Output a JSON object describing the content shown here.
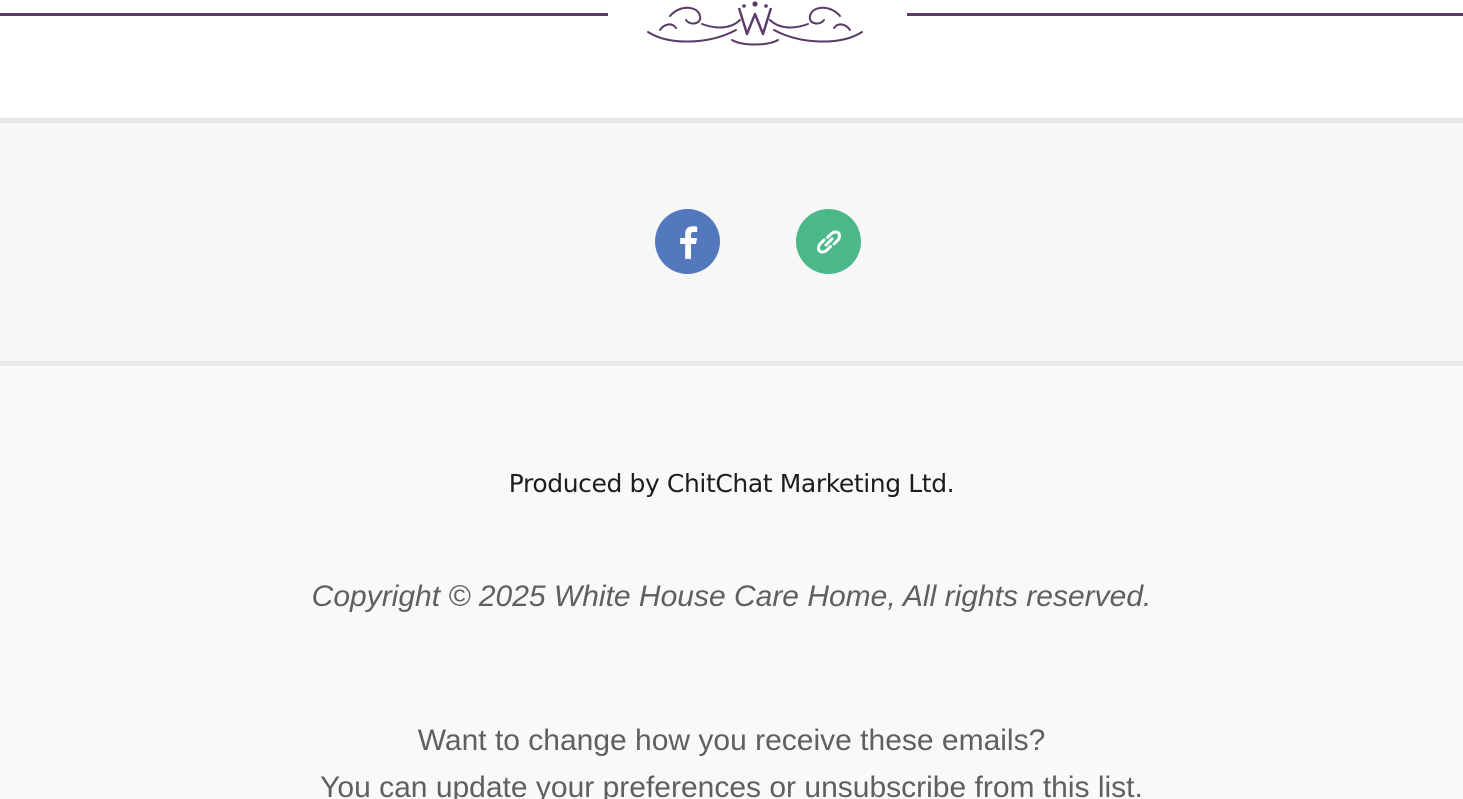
{
  "footer": {
    "produced_by": "Produced by ChitChat Marketing Ltd.",
    "copyright": "Copyright © 2025 White House Care Home, All rights reserved.",
    "preferences_question": "Want to change how you receive these emails?",
    "preferences_prefix": "You can ",
    "update_preferences_link": "update your preferences",
    "preferences_middle": " or ",
    "unsubscribe_link": "unsubscribe from this list",
    "preferences_suffix": "."
  },
  "social": {
    "icons": [
      "facebook-icon",
      "link-icon"
    ]
  },
  "colors": {
    "divider": "#5a3a66",
    "facebook": "#5478be",
    "website": "#4bb889",
    "footer_bg": "#f9f9f9"
  }
}
